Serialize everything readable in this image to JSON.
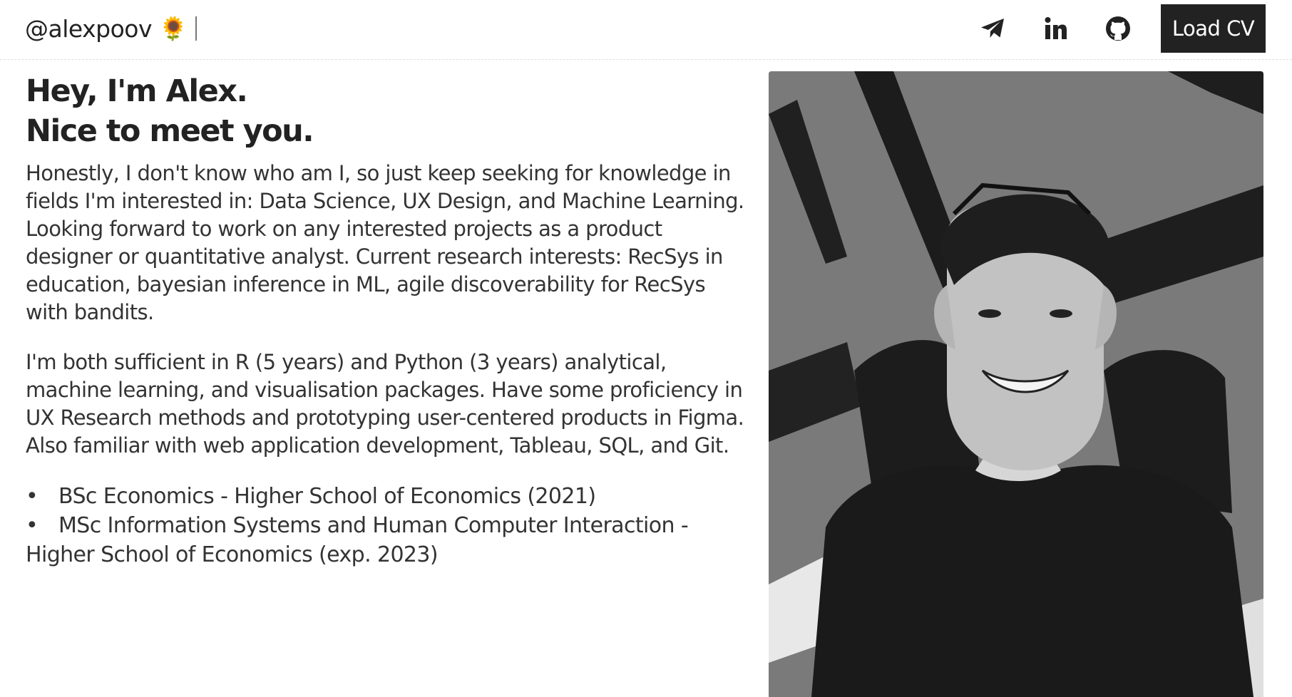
{
  "header": {
    "brand": "@alexpoov",
    "brand_emoji": "🌻",
    "icons": [
      "telegram-icon",
      "linkedin-icon",
      "github-icon"
    ],
    "cv_button": "Load CV"
  },
  "main": {
    "greeting_line1": "Hey, I'm Alex.",
    "greeting_line2": "Nice to meet you.",
    "paragraph1": "Honestly, I don't know who am I, so just keep seeking for knowledge in fields I'm interested in: Data Science, UX Design, and Machine Learning. Looking forward to work on any interested projects as a product designer or quantitative analyst. Current research interests: RecSys in education, bayesian inference in ML, agile discoverability for RecSys with bandits.",
    "paragraph2": "I'm both sufficient in R (5 years) and Python (3 years) analytical, machine learning, and visualisation packages. Have some proficiency in UX Research methods and prototyping user-centered products in Figma. Also familiar with web application development, Tableau, SQL, and Git.",
    "education": [
      "BSc Economics - Higher School of Economics (2021)",
      "MSc Information Systems and Human Computer Interaction - Higher School of Economics (exp. 2023)"
    ]
  },
  "colors": {
    "text": "#222222",
    "button_bg": "#222222",
    "button_text": "#ffffff",
    "background": "#ffffff"
  }
}
